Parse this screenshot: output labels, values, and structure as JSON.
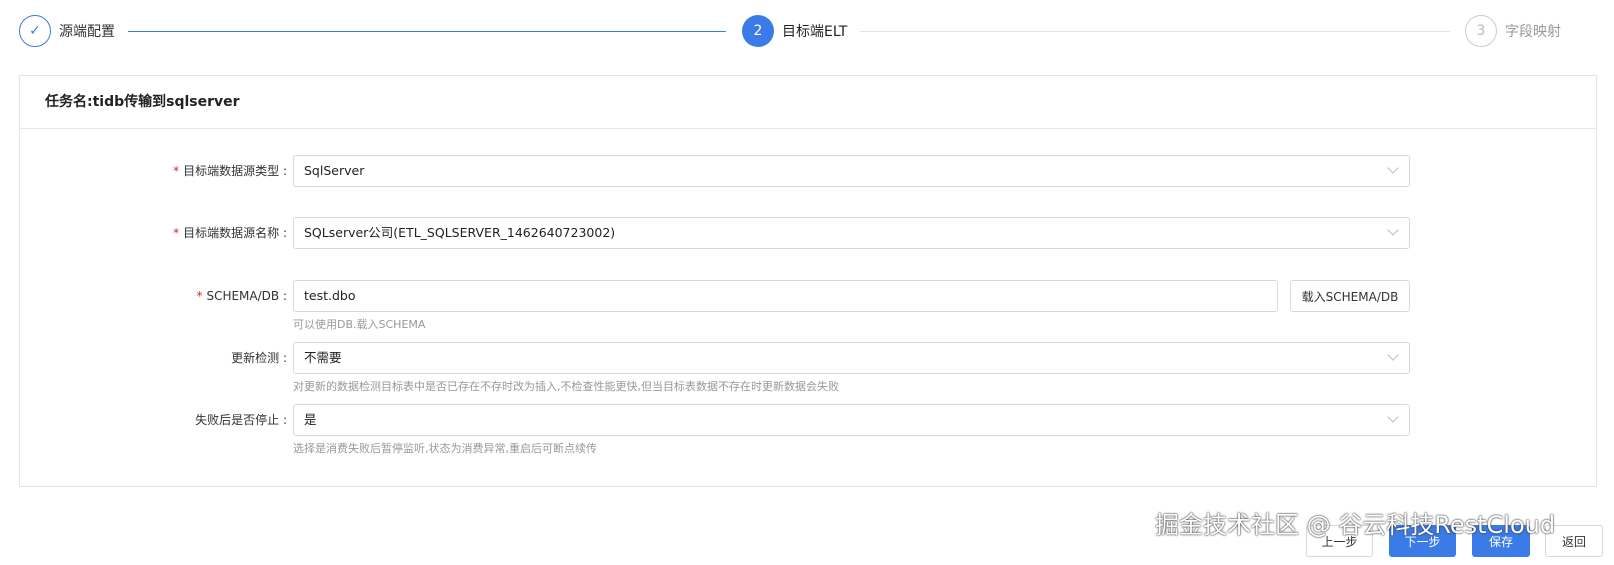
{
  "steps": [
    {
      "num": "1",
      "label": "源端配置",
      "state": "done"
    },
    {
      "num": "2",
      "label": "目标端ELT",
      "state": "active"
    },
    {
      "num": "3",
      "label": "字段映射",
      "state": "pending"
    }
  ],
  "task_title": "任务名:tidb传输到sqlserver",
  "form": {
    "target_type": {
      "label": "目标端数据源类型 :",
      "value": "SqlServer"
    },
    "target_name": {
      "label": "目标端数据源名称 :",
      "value": "SQLserver公司(ETL_SQLSERVER_1462640723002)"
    },
    "schema": {
      "label": "SCHEMA/DB :",
      "value": "test.dbo",
      "button": "载入SCHEMA/DB",
      "hint": "可以使用DB.载入SCHEMA"
    },
    "update_check": {
      "label": "更新检测 :",
      "value": "不需要",
      "hint": "对更新的数据检测目标表中是否已存在不存时改为插入,不检查性能更快,但当目标表数据不存在时更新数据会失败"
    },
    "stop_on_fail": {
      "label": "失败后是否停止 :",
      "value": "是",
      "hint": "选择是消费失败后暂停监听,状态为消费异常,重启后可断点续传"
    }
  },
  "buttons": {
    "prev": "上一步",
    "next": "下一步",
    "save": "保存",
    "back": "返回"
  },
  "watermark": "掘金技术社区 @ 谷云科技RestCloud",
  "colors": {
    "primary": "#3b7be8"
  }
}
